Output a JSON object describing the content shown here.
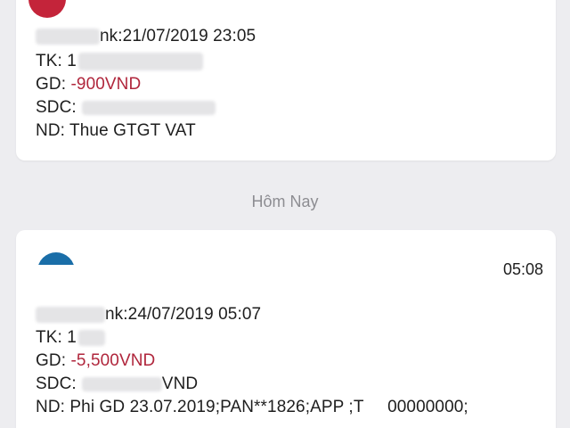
{
  "section_label": "Hôm Nay",
  "message1": {
    "header": "nk:21/07/2019 23:05",
    "tk_label": "TK: 1",
    "gd_label": "GD: ",
    "gd_amount": "-900VND",
    "sdc_label": "SDC:",
    "nd": "ND: Thue GTGT VAT"
  },
  "message2": {
    "time": "05:08",
    "header": "nk:24/07/2019 05:07",
    "tk_label": "TK: 1",
    "gd_label": "GD: ",
    "gd_amount": "-5,500VND",
    "sdc_label": "SDC:",
    "sdc_suffix": "VND",
    "nd": "ND: Phi GD 23.07.2019;PAN**1826;APP ;T     00000000;"
  },
  "colors": {
    "amount": "#b0263c",
    "background": "#ededf0",
    "card": "#ffffff"
  }
}
